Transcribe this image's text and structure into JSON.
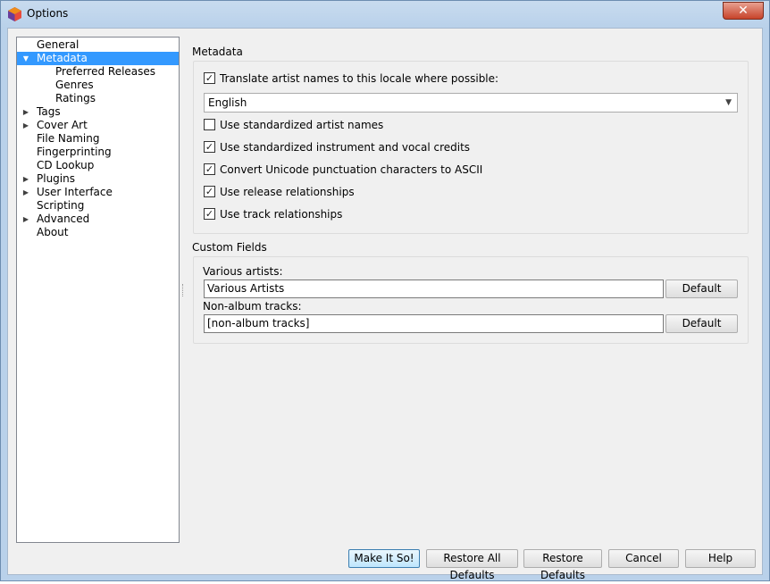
{
  "window": {
    "title": "Options",
    "close_label": "✕"
  },
  "sidebar": {
    "items": [
      {
        "label": "General",
        "indent": 0,
        "arrow": "",
        "selected": false
      },
      {
        "label": "Metadata",
        "indent": 0,
        "arrow": "down",
        "selected": true
      },
      {
        "label": "Preferred Releases",
        "indent": 1,
        "arrow": "",
        "selected": false
      },
      {
        "label": "Genres",
        "indent": 1,
        "arrow": "",
        "selected": false
      },
      {
        "label": "Ratings",
        "indent": 1,
        "arrow": "",
        "selected": false
      },
      {
        "label": "Tags",
        "indent": 0,
        "arrow": "right",
        "selected": false
      },
      {
        "label": "Cover Art",
        "indent": 0,
        "arrow": "right",
        "selected": false
      },
      {
        "label": "File Naming",
        "indent": 0,
        "arrow": "",
        "selected": false
      },
      {
        "label": "Fingerprinting",
        "indent": 0,
        "arrow": "",
        "selected": false
      },
      {
        "label": "CD Lookup",
        "indent": 0,
        "arrow": "",
        "selected": false
      },
      {
        "label": "Plugins",
        "indent": 0,
        "arrow": "right",
        "selected": false
      },
      {
        "label": "User Interface",
        "indent": 0,
        "arrow": "right",
        "selected": false
      },
      {
        "label": "Scripting",
        "indent": 0,
        "arrow": "",
        "selected": false
      },
      {
        "label": "Advanced",
        "indent": 0,
        "arrow": "right",
        "selected": false
      },
      {
        "label": "About",
        "indent": 0,
        "arrow": "",
        "selected": false
      }
    ]
  },
  "metadata": {
    "section_title": "Metadata",
    "translate": {
      "label": "Translate artist names to this locale where possible:",
      "checked": true
    },
    "locale_select": {
      "value": "English"
    },
    "options": [
      {
        "label": "Use standardized artist names",
        "checked": false
      },
      {
        "label": "Use standardized instrument and vocal credits",
        "checked": true
      },
      {
        "label": "Convert Unicode punctuation characters to ASCII",
        "checked": true
      },
      {
        "label": "Use release relationships",
        "checked": true
      },
      {
        "label": "Use track relationships",
        "checked": true
      }
    ]
  },
  "custom_fields": {
    "section_title": "Custom Fields",
    "various_artists": {
      "label": "Various artists:",
      "value": "Various Artists",
      "button": "Default"
    },
    "non_album": {
      "label": "Non-album tracks:",
      "value": "[non-album tracks]",
      "button": "Default"
    }
  },
  "footer": {
    "make_it_so": "Make It So!",
    "restore_all": "Restore All Defaults",
    "restore": "Restore Defaults",
    "cancel": "Cancel",
    "help": "Help"
  },
  "colors": {
    "selection": "#3399ff",
    "close_button": "#c7432a"
  }
}
